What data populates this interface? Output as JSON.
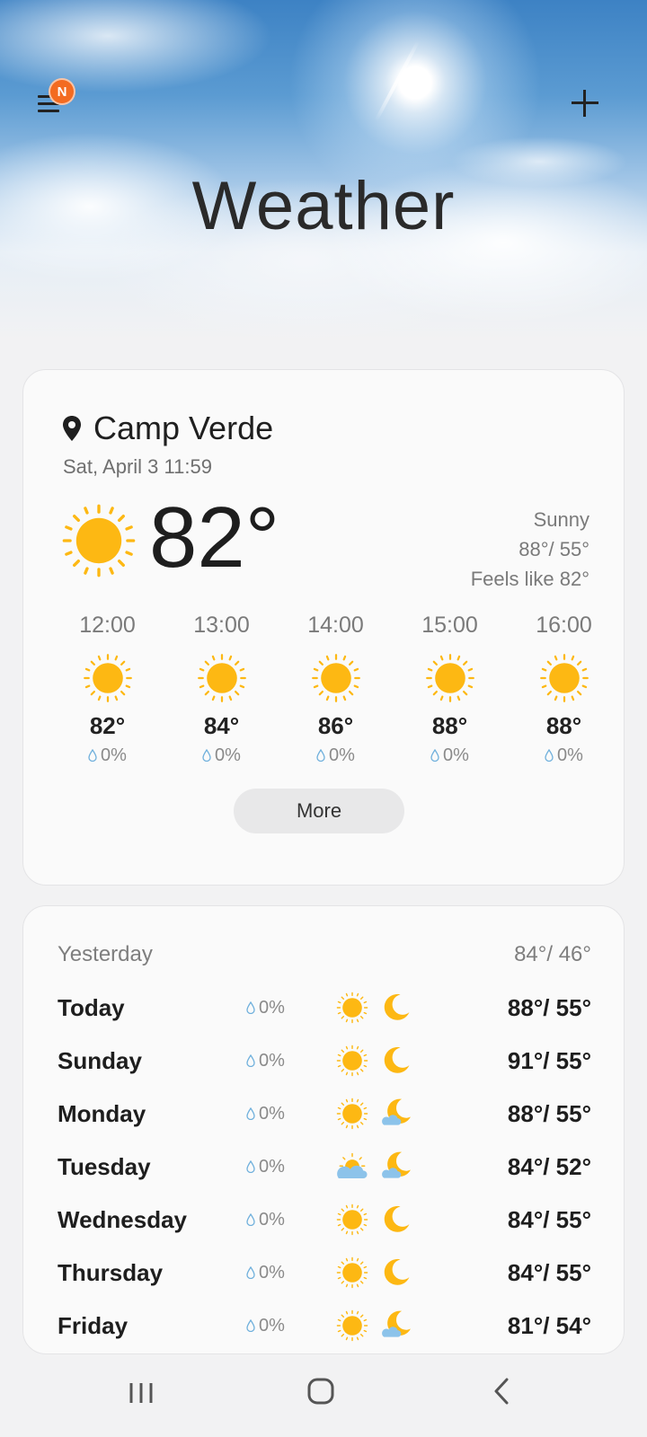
{
  "app": {
    "title": "Weather",
    "badge": "N"
  },
  "colors": {
    "sun": "#FDB813",
    "badge": "#F36B21",
    "cloud": "#8CC3EA"
  },
  "current": {
    "location": "Camp Verde",
    "datetime": "Sat, April 3 11:59",
    "temperature": "82°",
    "condition": "Sunny",
    "high_low": "88°/ 55°",
    "feels_like": "Feels like 82°",
    "icon": "sun-icon"
  },
  "hourly": [
    {
      "time": "12:00",
      "temp": "82°",
      "precip": "0%",
      "icon": "sun-icon"
    },
    {
      "time": "13:00",
      "temp": "84°",
      "precip": "0%",
      "icon": "sun-icon"
    },
    {
      "time": "14:00",
      "temp": "86°",
      "precip": "0%",
      "icon": "sun-icon"
    },
    {
      "time": "15:00",
      "temp": "88°",
      "precip": "0%",
      "icon": "sun-icon"
    },
    {
      "time": "16:00",
      "temp": "88°",
      "precip": "0%",
      "icon": "sun-icon"
    }
  ],
  "more_label": "More",
  "daily": {
    "yesterday": {
      "label": "Yesterday",
      "temps": "84°/ 46°"
    },
    "days": [
      {
        "name": "Today",
        "precip": "0%",
        "day_icon": "sun-icon",
        "night_icon": "moon-icon",
        "temps": "88°/ 55°"
      },
      {
        "name": "Sunday",
        "precip": "0%",
        "day_icon": "sun-icon",
        "night_icon": "moon-icon",
        "temps": "91°/ 55°"
      },
      {
        "name": "Monday",
        "precip": "0%",
        "day_icon": "sun-icon",
        "night_icon": "moon-cloud-icon",
        "temps": "88°/ 55°"
      },
      {
        "name": "Tuesday",
        "precip": "0%",
        "day_icon": "sun-cloud-icon",
        "night_icon": "moon-cloud-icon",
        "temps": "84°/ 52°"
      },
      {
        "name": "Wednesday",
        "precip": "0%",
        "day_icon": "sun-icon",
        "night_icon": "moon-icon",
        "temps": "84°/ 55°"
      },
      {
        "name": "Thursday",
        "precip": "0%",
        "day_icon": "sun-icon",
        "night_icon": "moon-icon",
        "temps": "84°/ 55°"
      },
      {
        "name": "Friday",
        "precip": "0%",
        "day_icon": "sun-icon",
        "night_icon": "moon-cloud-icon",
        "temps": "81°/ 54°"
      }
    ]
  },
  "navbar": {
    "recent": "recent-apps-icon",
    "home": "home-icon",
    "back": "back-icon"
  }
}
